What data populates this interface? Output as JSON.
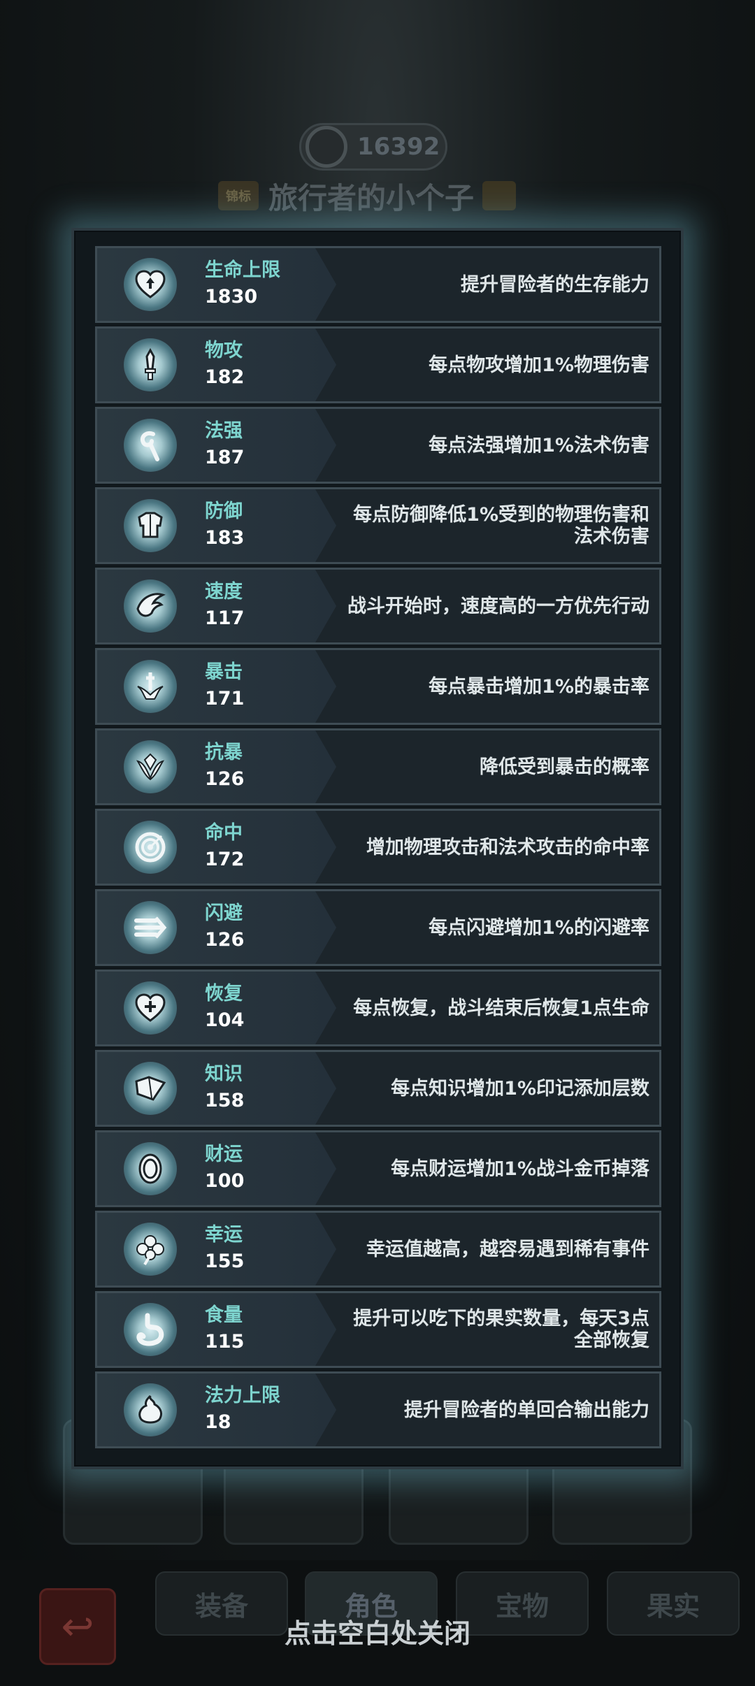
{
  "background": {
    "currency_value": "16392",
    "title_badge": "锦标",
    "player_title": "旅行者的小个子",
    "tabs": [
      "装备",
      "角色",
      "宝物",
      "果实"
    ],
    "active_tab": "角色"
  },
  "stats": [
    {
      "icon": "heart-up-icon",
      "label": "生命上限",
      "value": "1830",
      "desc": "提升冒险者的生存能力"
    },
    {
      "icon": "sword-icon",
      "label": "物攻",
      "value": "182",
      "desc": "每点物攻增加1%物理伤害"
    },
    {
      "icon": "staff-icon",
      "label": "法强",
      "value": "187",
      "desc": "每点法强增加1%法术伤害"
    },
    {
      "icon": "armor-icon",
      "label": "防御",
      "value": "183",
      "desc": "每点防御降低1%受到的物理伤害和法术伤害"
    },
    {
      "icon": "wing-icon",
      "label": "速度",
      "value": "117",
      "desc": "战斗开始时，速度高的一方优先行动"
    },
    {
      "icon": "crit-icon",
      "label": "暴击",
      "value": "171",
      "desc": "每点暴击增加1%的暴击率"
    },
    {
      "icon": "crit-resist-icon",
      "label": "抗暴",
      "value": "126",
      "desc": "降低受到暴击的概率"
    },
    {
      "icon": "target-icon",
      "label": "命中",
      "value": "172",
      "desc": "增加物理攻击和法术攻击的命中率"
    },
    {
      "icon": "dodge-icon",
      "label": "闪避",
      "value": "126",
      "desc": "每点闪避增加1%的闪避率"
    },
    {
      "icon": "heart-plus-icon",
      "label": "恢复",
      "value": "104",
      "desc": "每点恢复，战斗结束后恢复1点生命"
    },
    {
      "icon": "book-icon",
      "label": "知识",
      "value": "158",
      "desc": "每点知识增加1%印记添加层数"
    },
    {
      "icon": "coin-icon",
      "label": "财运",
      "value": "100",
      "desc": "每点财运增加1%战斗金币掉落"
    },
    {
      "icon": "clover-icon",
      "label": "幸运",
      "value": "155",
      "desc": "幸运值越高，越容易遇到稀有事件"
    },
    {
      "icon": "stomach-icon",
      "label": "食量",
      "value": "115",
      "desc": "提升可以吃下的果实数量，每天3点全部恢复"
    },
    {
      "icon": "mana-drop-icon",
      "label": "法力上限",
      "value": "18",
      "desc": "提升冒险者的单回合输出能力"
    }
  ],
  "close_hint": "点击空白处关闭",
  "colors": {
    "label": "#7ed5cf",
    "value": "#ffffff",
    "panel_glow": "#78c8dc"
  }
}
